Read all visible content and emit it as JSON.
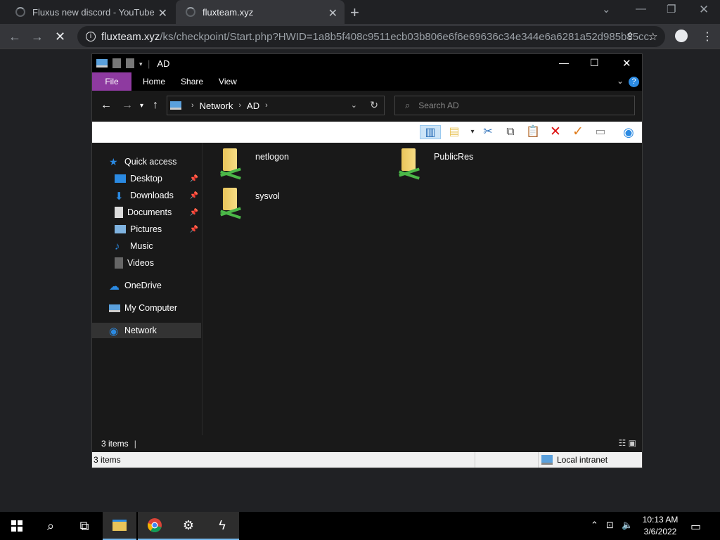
{
  "browser": {
    "tabs": [
      {
        "title": "Fluxus new discord - YouTube",
        "loading": true
      },
      {
        "title": "fluxteam.xyz",
        "loading": true
      }
    ],
    "url_host": "fluxteam.xyz",
    "url_path": "/ks/checkpoint/Start.php?HWID=1a8b5f408c9511ecb03b806e6f6e69636c34e344e6a6281a52d985b85cc..."
  },
  "explorer": {
    "title": "AD",
    "ribbon_tabs": [
      "File",
      "Home",
      "Share",
      "View"
    ],
    "help_label": "?",
    "address": {
      "root": "Network",
      "folder": "AD"
    },
    "search_placeholder": "Search AD",
    "nav": {
      "quick_access": "Quick access",
      "desktop": "Desktop",
      "downloads": "Downloads",
      "documents": "Documents",
      "pictures": "Pictures",
      "music": "Music",
      "videos": "Videos",
      "onedrive": "OneDrive",
      "my_computer": "My Computer",
      "network": "Network"
    },
    "items": [
      {
        "name": "netlogon"
      },
      {
        "name": "PublicRes"
      },
      {
        "name": "sysvol"
      }
    ],
    "status_count": "3 items",
    "status_bar_count": "3 items",
    "zone": "Local intranet"
  },
  "taskbar": {
    "time": "10:13 AM",
    "date": "3/6/2022"
  },
  "colors": {
    "file_tab": "#8e3aa0",
    "accent": "#2b8ae2"
  }
}
